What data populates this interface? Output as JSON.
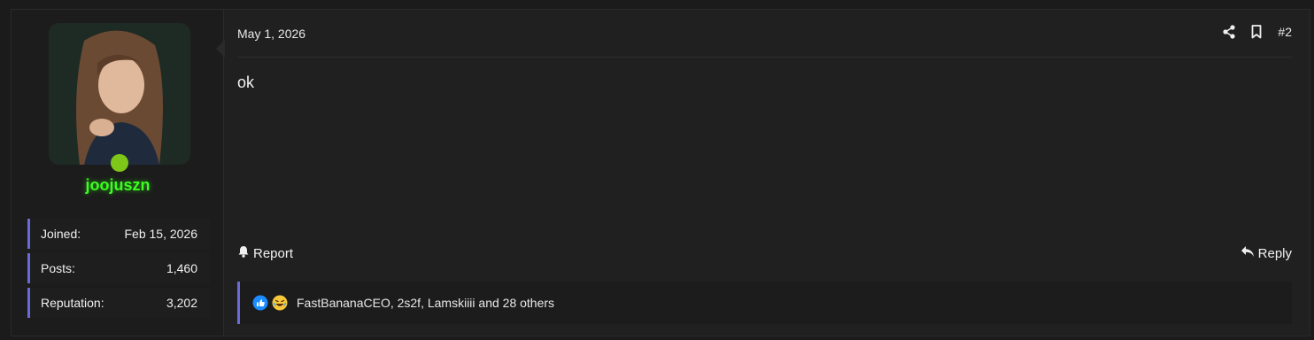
{
  "user": {
    "username": "joojuszn",
    "online": true,
    "stats": [
      {
        "label": "Joined:",
        "value": "Feb 15, 2026"
      },
      {
        "label": "Posts:",
        "value": "1,460"
      },
      {
        "label": "Reputation:",
        "value": "3,202"
      }
    ]
  },
  "post": {
    "date": "May 1, 2026",
    "number": "#2",
    "message": "ok",
    "actions": {
      "report": "Report",
      "reply": "Reply"
    },
    "header_icons": [
      "share-icon",
      "bookmark-icon"
    ],
    "reactions": {
      "icons": [
        "like-icon",
        "laugh-icon"
      ],
      "summary": "FastBananaCEO, 2s2f, Lamskiiii and 28 others"
    }
  },
  "colors": {
    "username": "#3bff1e",
    "online": "#7ec617",
    "accent_border": "#6a6ad8",
    "background": "#202020"
  }
}
